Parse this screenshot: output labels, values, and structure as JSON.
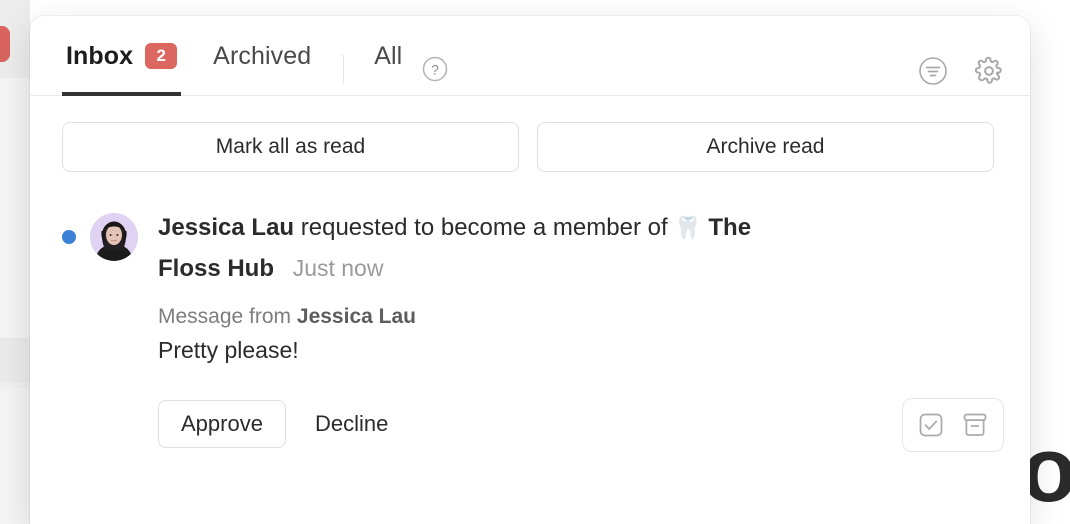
{
  "background": {
    "big_text": "lo",
    "badge_visible": true
  },
  "header": {
    "tabs": [
      {
        "label": "Inbox",
        "badge": "2",
        "active": true
      },
      {
        "label": "Archived",
        "badge": "",
        "active": false
      },
      {
        "label": "All",
        "badge": "",
        "active": false
      }
    ],
    "help_icon": "help-circle-icon",
    "actions": [
      {
        "name": "filter-icon",
        "label": "Filter"
      },
      {
        "name": "settings-gear-icon",
        "label": "Settings"
      }
    ]
  },
  "bulk_actions": {
    "mark_all_read": "Mark all as read",
    "archive_read": "Archive read"
  },
  "notification": {
    "unread": true,
    "avatar_alt": "Jessica Lau",
    "actor": "Jessica Lau",
    "action_text": "requested to become a member of",
    "group_emoji": "🦷",
    "group_name": "The Floss Hub",
    "timestamp": "Just now",
    "message_from_label": "Message from",
    "message_from_name": "Jessica Lau",
    "message_body": "Pretty please!",
    "cta": {
      "approve": "Approve",
      "decline": "Decline"
    },
    "row_actions": [
      {
        "name": "mark-as-read-icon",
        "label": "Mark as read"
      },
      {
        "name": "archive-icon",
        "label": "Archive"
      }
    ]
  },
  "colors": {
    "badge_red": "#dc6660",
    "unread_blue": "#3b82d6",
    "active_tab_underline": "#333333",
    "avatar_bg": "#dfd2f2"
  }
}
